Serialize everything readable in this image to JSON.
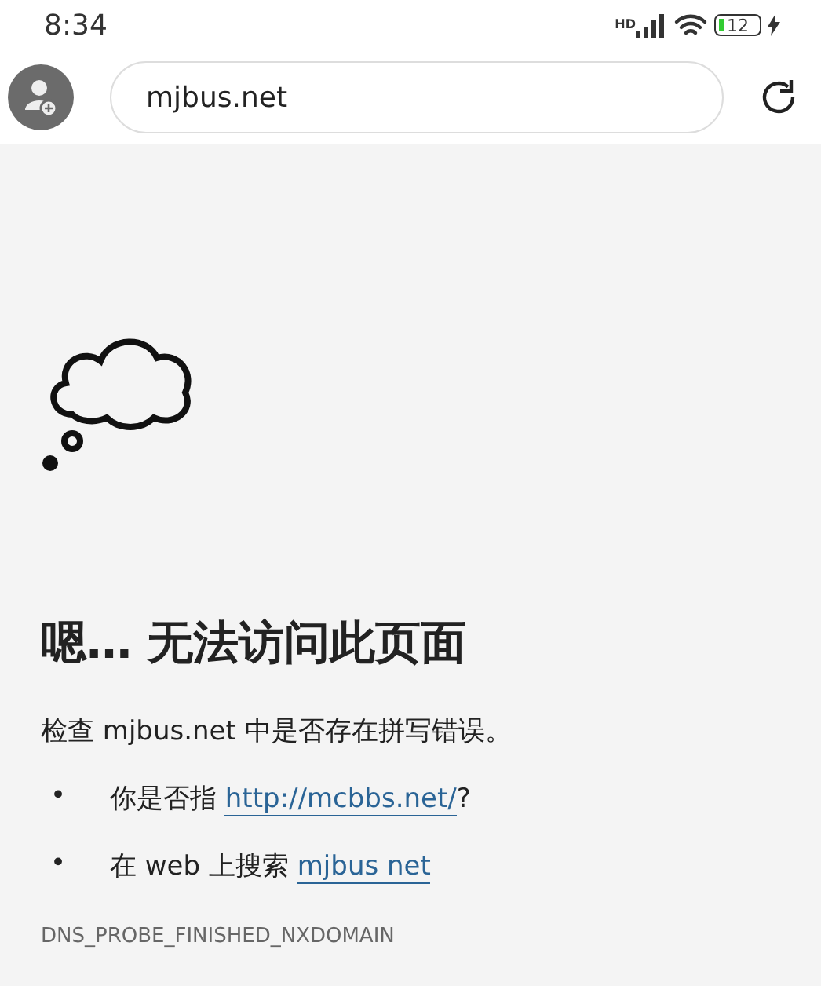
{
  "status_bar": {
    "time": "8:34",
    "network_label": "HD",
    "battery": "12",
    "charging": true
  },
  "toolbar": {
    "url": "mjbus.net"
  },
  "error": {
    "title": "嗯… 无法访问此页面",
    "message": "检查 mjbus.net 中是否存在拼写错误。",
    "suggestions": [
      {
        "bullet": "•",
        "before": "你是否指 ",
        "link": "http://mcbbs.net/",
        "after": "?"
      },
      {
        "bullet": "•",
        "before": "在 web 上搜索 ",
        "link": "mjbus net"
      }
    ],
    "code": "DNS_PROBE_FINISHED_NXDOMAIN"
  }
}
